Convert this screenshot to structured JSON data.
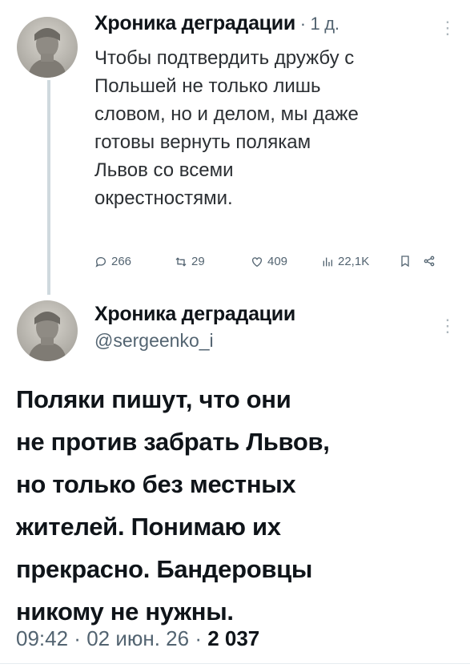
{
  "reply_tweet": {
    "author_name": "Хроника деградации",
    "time_sep": " · ",
    "time": "1 д.",
    "text": "Чтобы подтвердить дружбу с\nПольшей не только лишь\nсловом, но и делом, мы даже\nготовы вернуть полякам\nЛьвов со всеми\nокрестностями.",
    "replies": "266",
    "retweets": "29",
    "likes": "409",
    "views": "22,1K"
  },
  "main_tweet": {
    "author_name": "Хроника деградации",
    "handle": "@sergeenko_i",
    "text": "Поляки пишут, что они\nне против забрать Львов,\nно только без местных\nжителей. Понимаю их\nпрекрасно. Бандеровцы\nникому не нужны.",
    "time": "09:42",
    "sep1": " · ",
    "date": "02 июн. 26",
    "sep2": " · ",
    "views": "2 037"
  },
  "icons": [
    "avatar-image",
    "reply-icon",
    "retweet-icon",
    "like-icon",
    "views-icon",
    "bookmark-icon",
    "share-icon",
    "more-icon"
  ],
  "colors": {
    "text": "#0f1419",
    "secondary": "#536471",
    "thread_line": "#cfd9de"
  }
}
